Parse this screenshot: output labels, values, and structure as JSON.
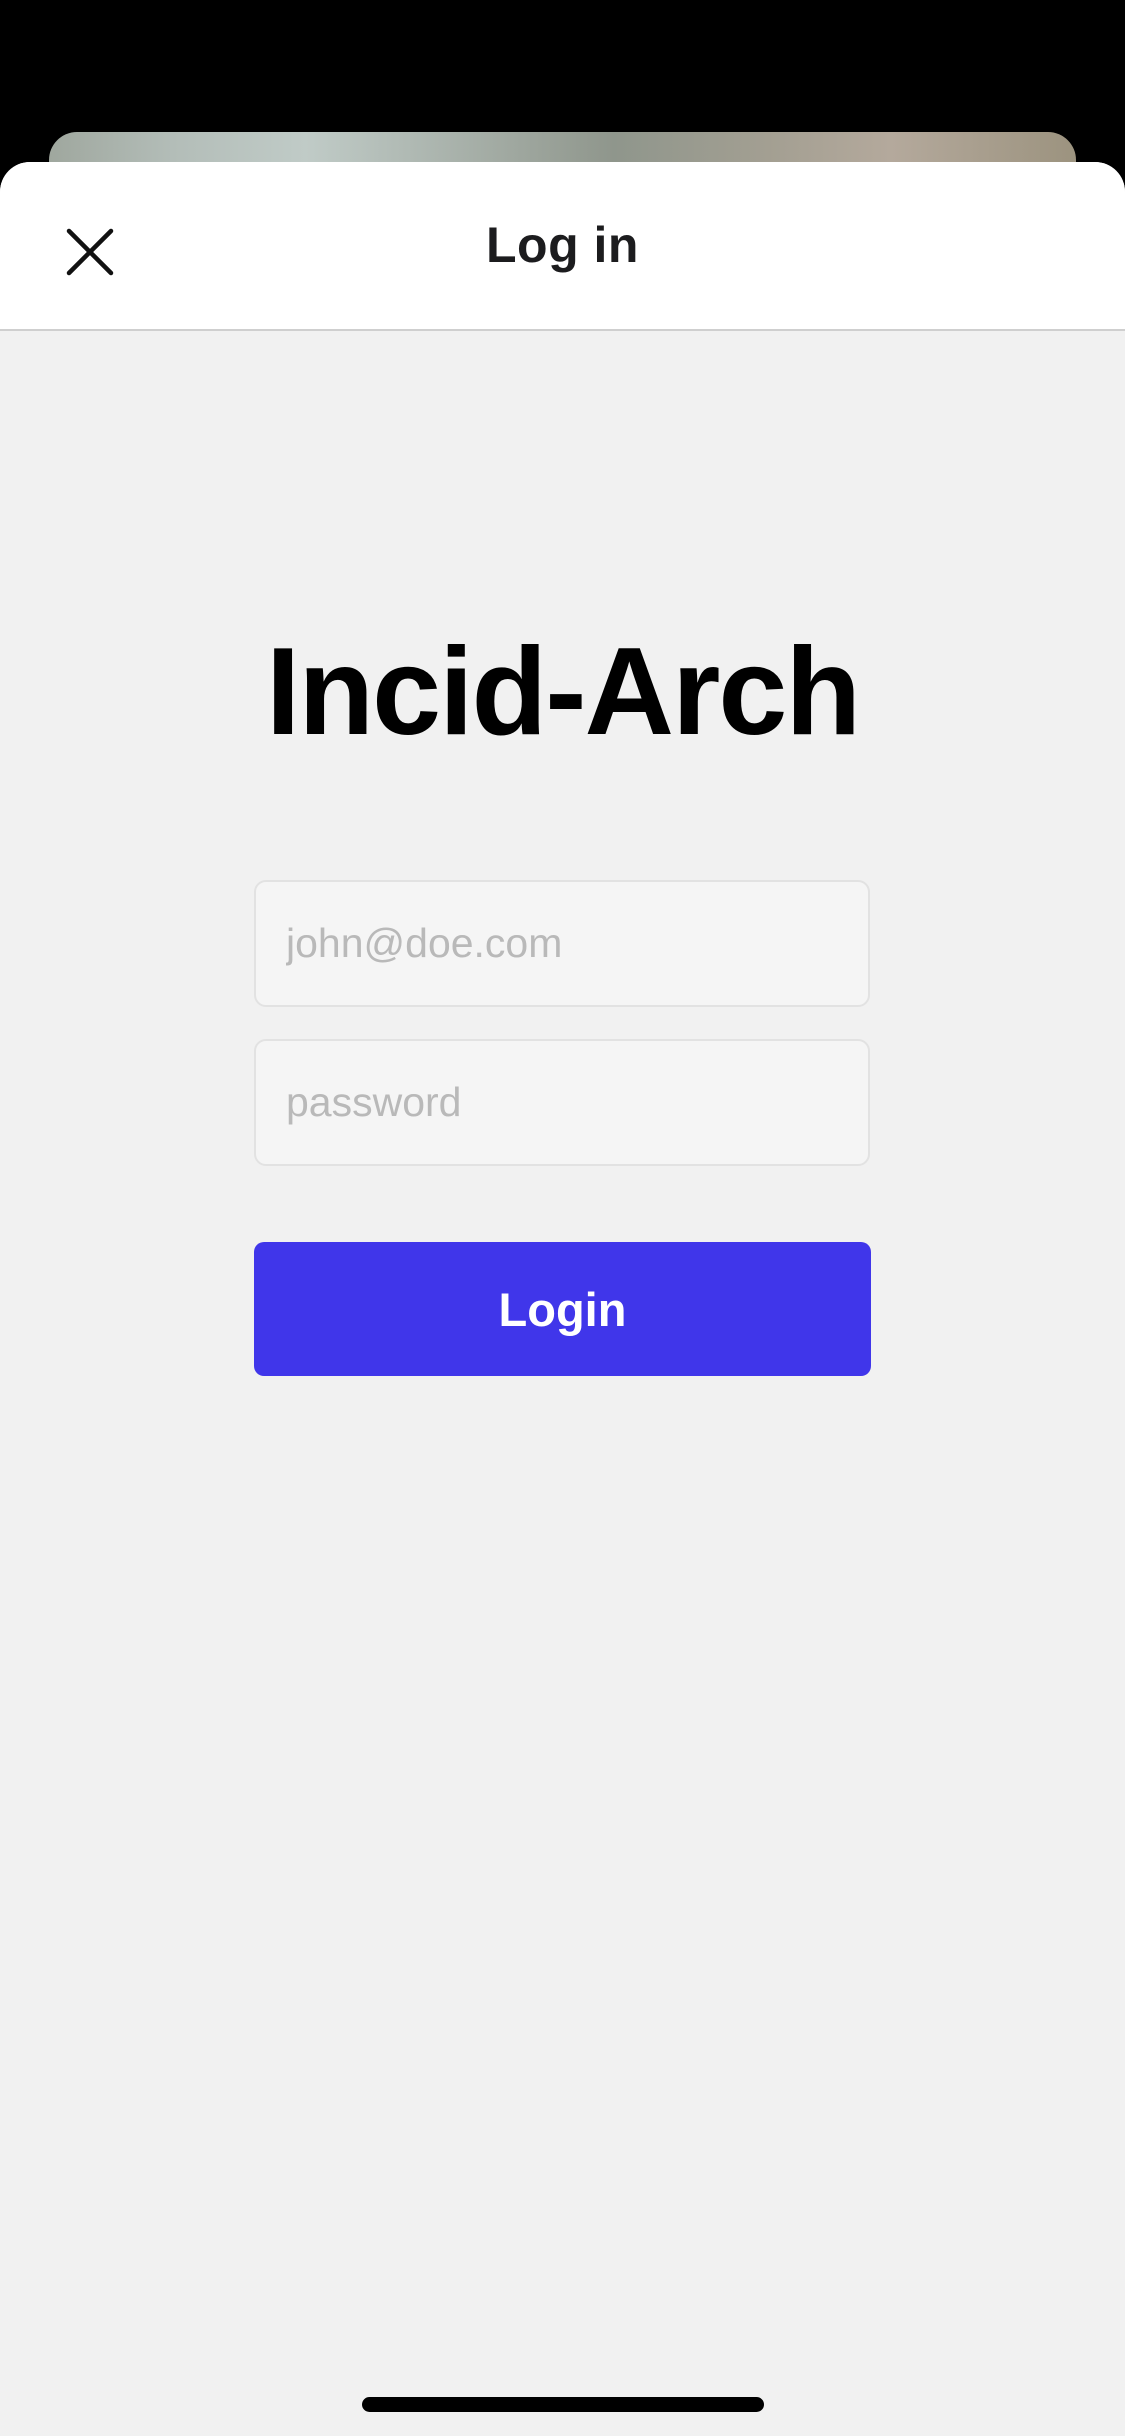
{
  "header": {
    "title": "Log in",
    "close_icon": "close-icon"
  },
  "main": {
    "brand_title": "Incid-Arch",
    "email": {
      "value": "",
      "placeholder": "john@doe.com"
    },
    "password": {
      "value": "",
      "placeholder": "password"
    },
    "login_label": "Login"
  },
  "colors": {
    "accent": "#4036ea",
    "sheet_background": "#f1f1f1",
    "nav_background": "#ffffff",
    "status_background": "#000000"
  }
}
